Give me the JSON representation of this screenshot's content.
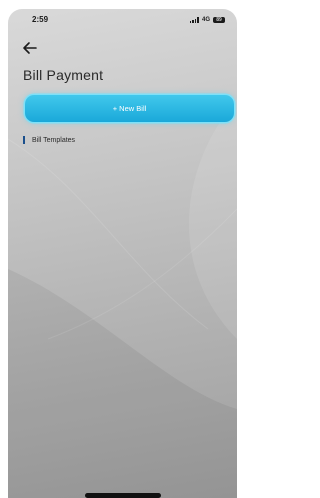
{
  "status_bar": {
    "time": "2:59",
    "network": "4G",
    "battery": "89"
  },
  "page": {
    "title": "Bill Payment"
  },
  "actions": {
    "new_bill_label": "+ New Bill"
  },
  "sections": {
    "templates_label": "Bill Templates"
  },
  "icons": {
    "back": "arrow-left-icon"
  },
  "colors": {
    "accent": "#22b3e0",
    "section_marker": "#1a4f8c",
    "background": "#bdbdbd"
  }
}
